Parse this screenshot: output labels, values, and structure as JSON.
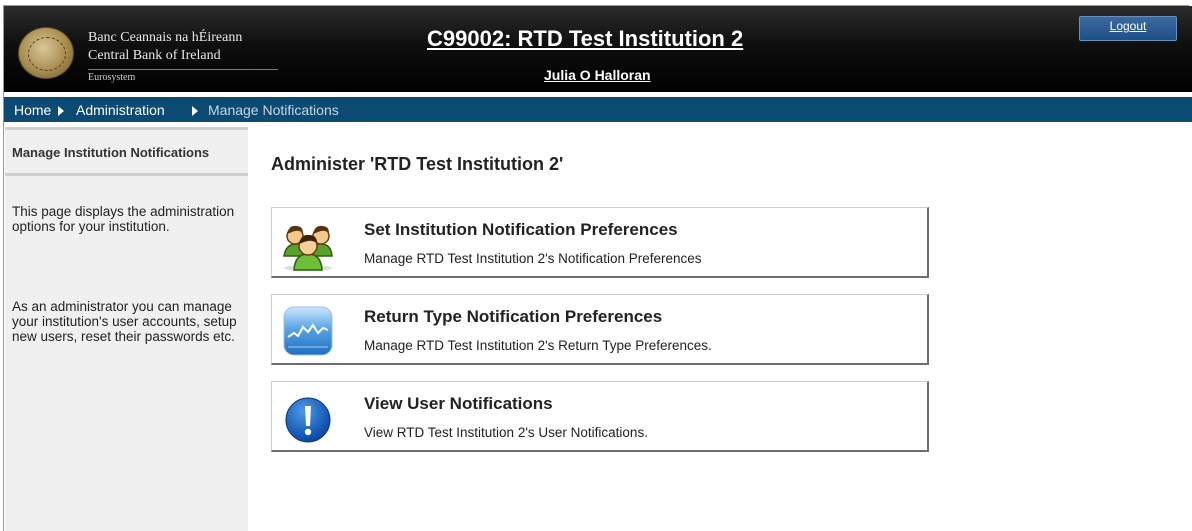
{
  "header": {
    "brand_irish": "Banc Ceannais na hÉireann",
    "brand_english": "Central Bank of Ireland",
    "brand_sub": "Eurosystem",
    "institution_title": "C99002: RTD Test Institution 2",
    "user_name": "Julia O Halloran",
    "logout_label": "Logout"
  },
  "breadcrumb": {
    "items": [
      "Home",
      "Administration",
      "Manage Notifications"
    ]
  },
  "sidebar": {
    "title": "Manage Institution Notifications",
    "paragraph1": "This page displays the administration options for your institution.",
    "paragraph2": "As an administrator you can manage your institution's user accounts, setup new users, reset their passwords etc."
  },
  "main": {
    "heading": "Administer 'RTD Test Institution 2'",
    "cards": [
      {
        "title": "Set Institution Notification Preferences",
        "description": "Manage RTD Test Institution 2's Notification Preferences",
        "icon": "users-group-icon"
      },
      {
        "title": "Return Type Notification Preferences",
        "description": "Manage RTD Test Institution 2's Return Type Preferences.",
        "icon": "stocks-chart-icon"
      },
      {
        "title": "View User Notifications",
        "description": "View RTD Test Institution 2's User Notifications.",
        "icon": "alert-exclamation-icon"
      }
    ]
  },
  "colors": {
    "header_bg": "#000000",
    "nav_bar": "#0a4a73",
    "logout_button": "#1e4f84",
    "sidebar_bg": "#f0f0f0"
  }
}
